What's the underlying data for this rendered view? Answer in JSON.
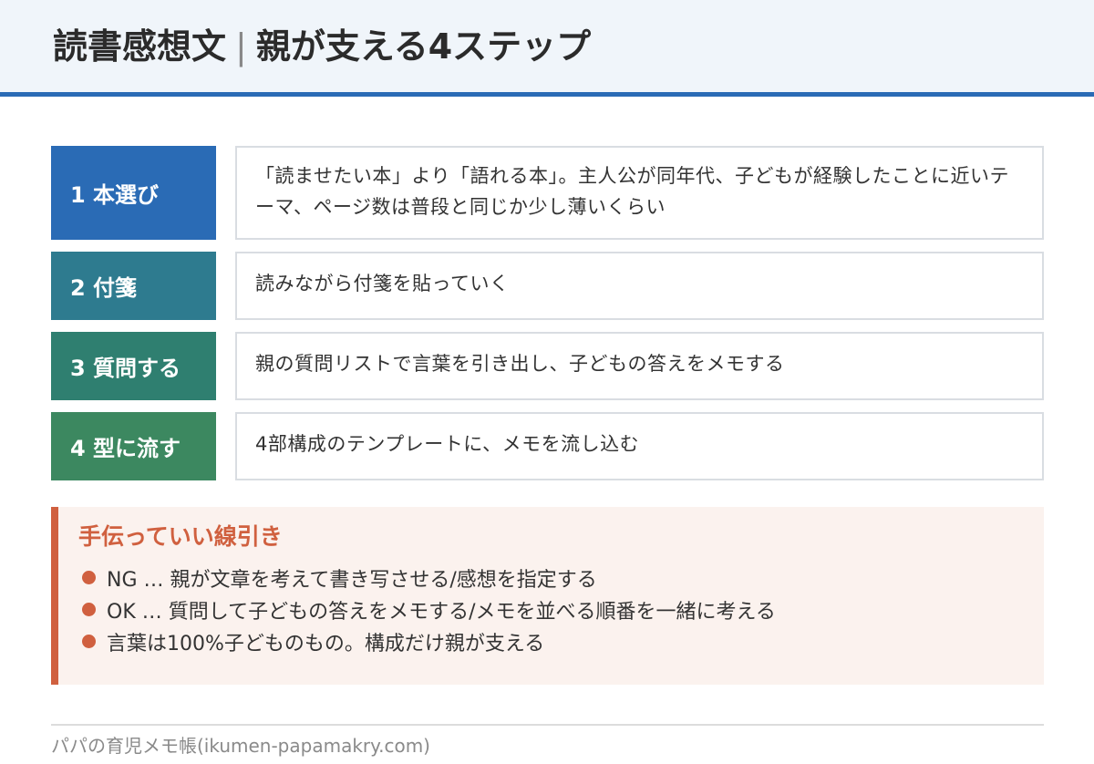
{
  "header": {
    "title_main": "読書感想文",
    "separator": "|",
    "title_sub": "親が支える4ステップ"
  },
  "colors": {
    "header_bg": "#f0f5fa",
    "header_border": "#2a6bb5",
    "step1": "#2a6bb5",
    "step2": "#2e7b8f",
    "step3": "#2f7f70",
    "step4": "#3c8860",
    "accent": "#d0603f",
    "tips_bg": "#fbf2ee"
  },
  "steps": [
    {
      "label": "1 本選び",
      "text": "「読ませたい本」より「語れる本」。主人公が同年代、子どもが経験したことに近いテーマ、ページ数は普段と同じか少し薄いくらい"
    },
    {
      "label": "2 付箋",
      "text": "読みながら付箋を貼っていく"
    },
    {
      "label": "3 質問する",
      "text": "親の質問リストで言葉を引き出し、子どもの答えをメモする"
    },
    {
      "label": "4 型に流す",
      "text": "4部構成のテンプレートに、メモを流し込む"
    }
  ],
  "tips": {
    "title": "手伝っていい線引き",
    "items": [
      "NG … 親が文章を考えて書き写させる/感想を指定する",
      "OK … 質問して子どもの答えをメモする/メモを並べる順番を一緒に考える",
      "言葉は100%子どものもの。構成だけ親が支える"
    ]
  },
  "footer": {
    "text": "パパの育児メモ帳(ikumen-papamakry.com)"
  }
}
